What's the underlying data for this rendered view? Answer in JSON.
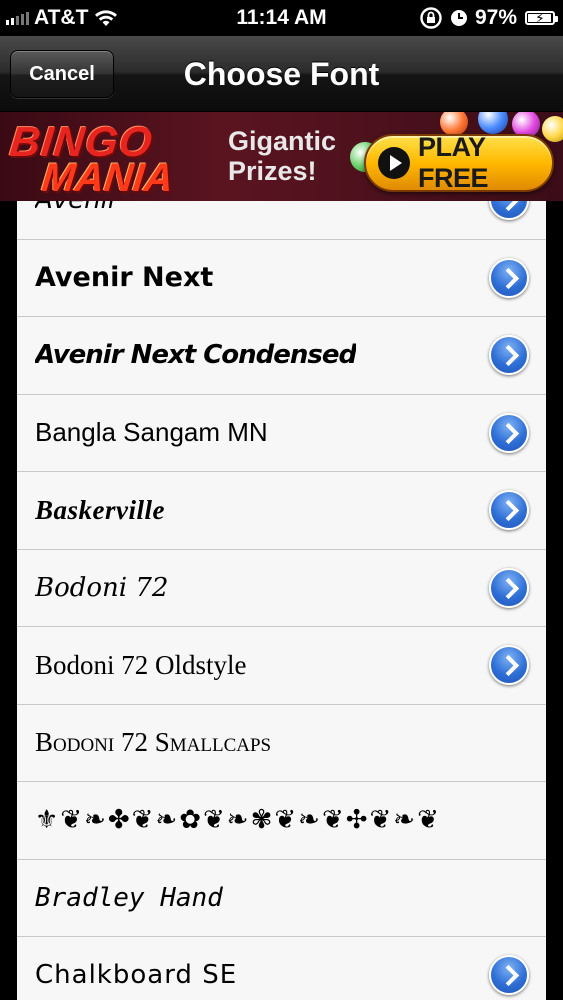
{
  "status_bar": {
    "carrier": "AT&T",
    "time": "11:14 AM",
    "battery": "97%",
    "battery_level": 0.97
  },
  "nav": {
    "cancel_label": "Cancel",
    "title": "Choose Font"
  },
  "ad": {
    "logo_line1": "BINGO",
    "logo_line2": "MANIA",
    "tagline_line1": "Gigantic",
    "tagline_line2": "Prizes!",
    "cta": "PLAY FREE"
  },
  "fonts": [
    {
      "name": "Avenir",
      "has_detail": true
    },
    {
      "name": "Avenir Next",
      "has_detail": true
    },
    {
      "name": "Avenir Next Condensed",
      "has_detail": true
    },
    {
      "name": "Bangla Sangam MN",
      "has_detail": true
    },
    {
      "name": "Baskerville",
      "has_detail": true
    },
    {
      "name": "Bodoni 72",
      "has_detail": true
    },
    {
      "name": "Bodoni 72 Oldstyle",
      "has_detail": true
    },
    {
      "name": "Bodoni 72 Smallcaps",
      "has_detail": false
    },
    {
      "name": "⚜❦❧✤❦❧✿❦❧✾❦❧❦✣❦❧❦",
      "has_detail": false
    },
    {
      "name": "Bradley Hand",
      "has_detail": false
    },
    {
      "name": "Chalkboard SE",
      "has_detail": true
    }
  ]
}
